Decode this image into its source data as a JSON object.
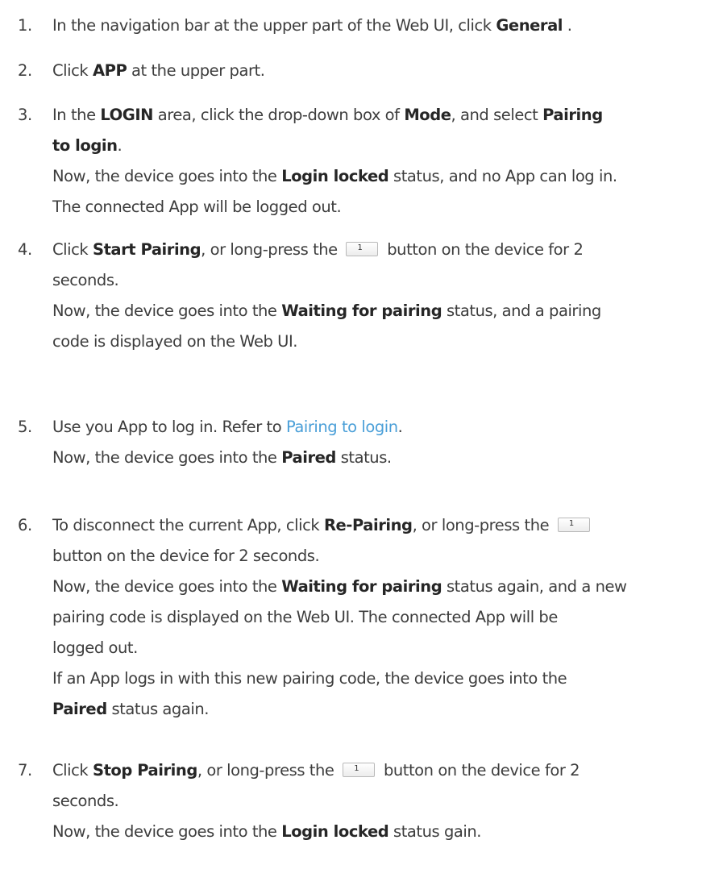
{
  "steps": [
    {
      "num": "1.",
      "lines": [
        [
          [
            "t",
            "In the navigation bar at the upper part of the Web UI, click "
          ],
          [
            "b",
            "General"
          ],
          [
            "t",
            " ."
          ]
        ]
      ]
    },
    {
      "num": "2.",
      "lines": [
        [
          [
            "t",
            "Click "
          ],
          [
            "b",
            "APP"
          ],
          [
            "t",
            " at the upper part."
          ]
        ]
      ]
    },
    {
      "num": "3.",
      "lines": [
        [
          [
            "t",
            "In the "
          ],
          [
            "b",
            "LOGIN"
          ],
          [
            "t",
            " area, click the drop-down box of "
          ],
          [
            "b",
            "Mode"
          ],
          [
            "t",
            ", and select "
          ],
          [
            "b",
            "Pairing"
          ]
        ],
        [
          [
            "b",
            "to login"
          ],
          [
            "t",
            "."
          ]
        ],
        [
          [
            "t",
            "Now, the device goes into the "
          ],
          [
            "b",
            "Login locked"
          ],
          [
            "t",
            " status, and no App can log in."
          ]
        ],
        [
          [
            "t",
            "The connected App will be logged out."
          ]
        ]
      ]
    },
    {
      "num": "4.",
      "lines": [
        [
          [
            "t",
            "Click "
          ],
          [
            "b",
            "Start Pairing"
          ],
          [
            "t",
            ", or long-press the "
          ],
          [
            "k",
            "1"
          ],
          [
            "t",
            " button on the device for 2"
          ]
        ],
        [
          [
            "t",
            "seconds."
          ]
        ],
        [
          [
            "t",
            "Now, the device goes into the "
          ],
          [
            "b",
            "Waiting for pairing"
          ],
          [
            "t",
            " status, and a pairing"
          ]
        ],
        [
          [
            "t",
            "code is displayed on the Web UI."
          ]
        ]
      ]
    },
    {
      "num": "5.",
      "lines": [
        [
          [
            "t",
            "Use you App to log in. Refer to "
          ],
          [
            "a",
            "Pairing to login"
          ],
          [
            "t",
            "."
          ]
        ],
        [
          [
            "t",
            "Now, the device goes into the "
          ],
          [
            "b",
            "Paired"
          ],
          [
            "t",
            " status."
          ]
        ]
      ]
    },
    {
      "num": "6.",
      "lines": [
        [
          [
            "t",
            "To disconnect the current App, click "
          ],
          [
            "b",
            "Re-Pairing"
          ],
          [
            "t",
            ", or long-press the "
          ],
          [
            "k",
            "1"
          ]
        ],
        [
          [
            "t",
            "button on the device for 2 seconds."
          ]
        ],
        [
          [
            "t",
            "Now, the device goes into the "
          ],
          [
            "b",
            "Waiting for pairing"
          ],
          [
            "t",
            " status again, and a new"
          ]
        ],
        [
          [
            "t",
            "pairing code is displayed on the Web UI. The connected App will be"
          ]
        ],
        [
          [
            "t",
            "logged out."
          ]
        ],
        [
          [
            "t",
            "If an App logs in with this new pairing code, the device goes into the"
          ]
        ],
        [
          [
            "b",
            "Paired"
          ],
          [
            "t",
            " status again."
          ]
        ]
      ]
    },
    {
      "num": "7.",
      "lines": [
        [
          [
            "t",
            "Click "
          ],
          [
            "b",
            "Stop Pairing"
          ],
          [
            "t",
            ", or long-press the "
          ],
          [
            "k",
            "1"
          ],
          [
            "t",
            " button on the device for 2"
          ]
        ],
        [
          [
            "t",
            "seconds."
          ]
        ],
        [
          [
            "t",
            "Now, the device goes into the "
          ],
          [
            "b",
            "Login locked"
          ],
          [
            "t",
            " status gain."
          ]
        ]
      ]
    }
  ]
}
